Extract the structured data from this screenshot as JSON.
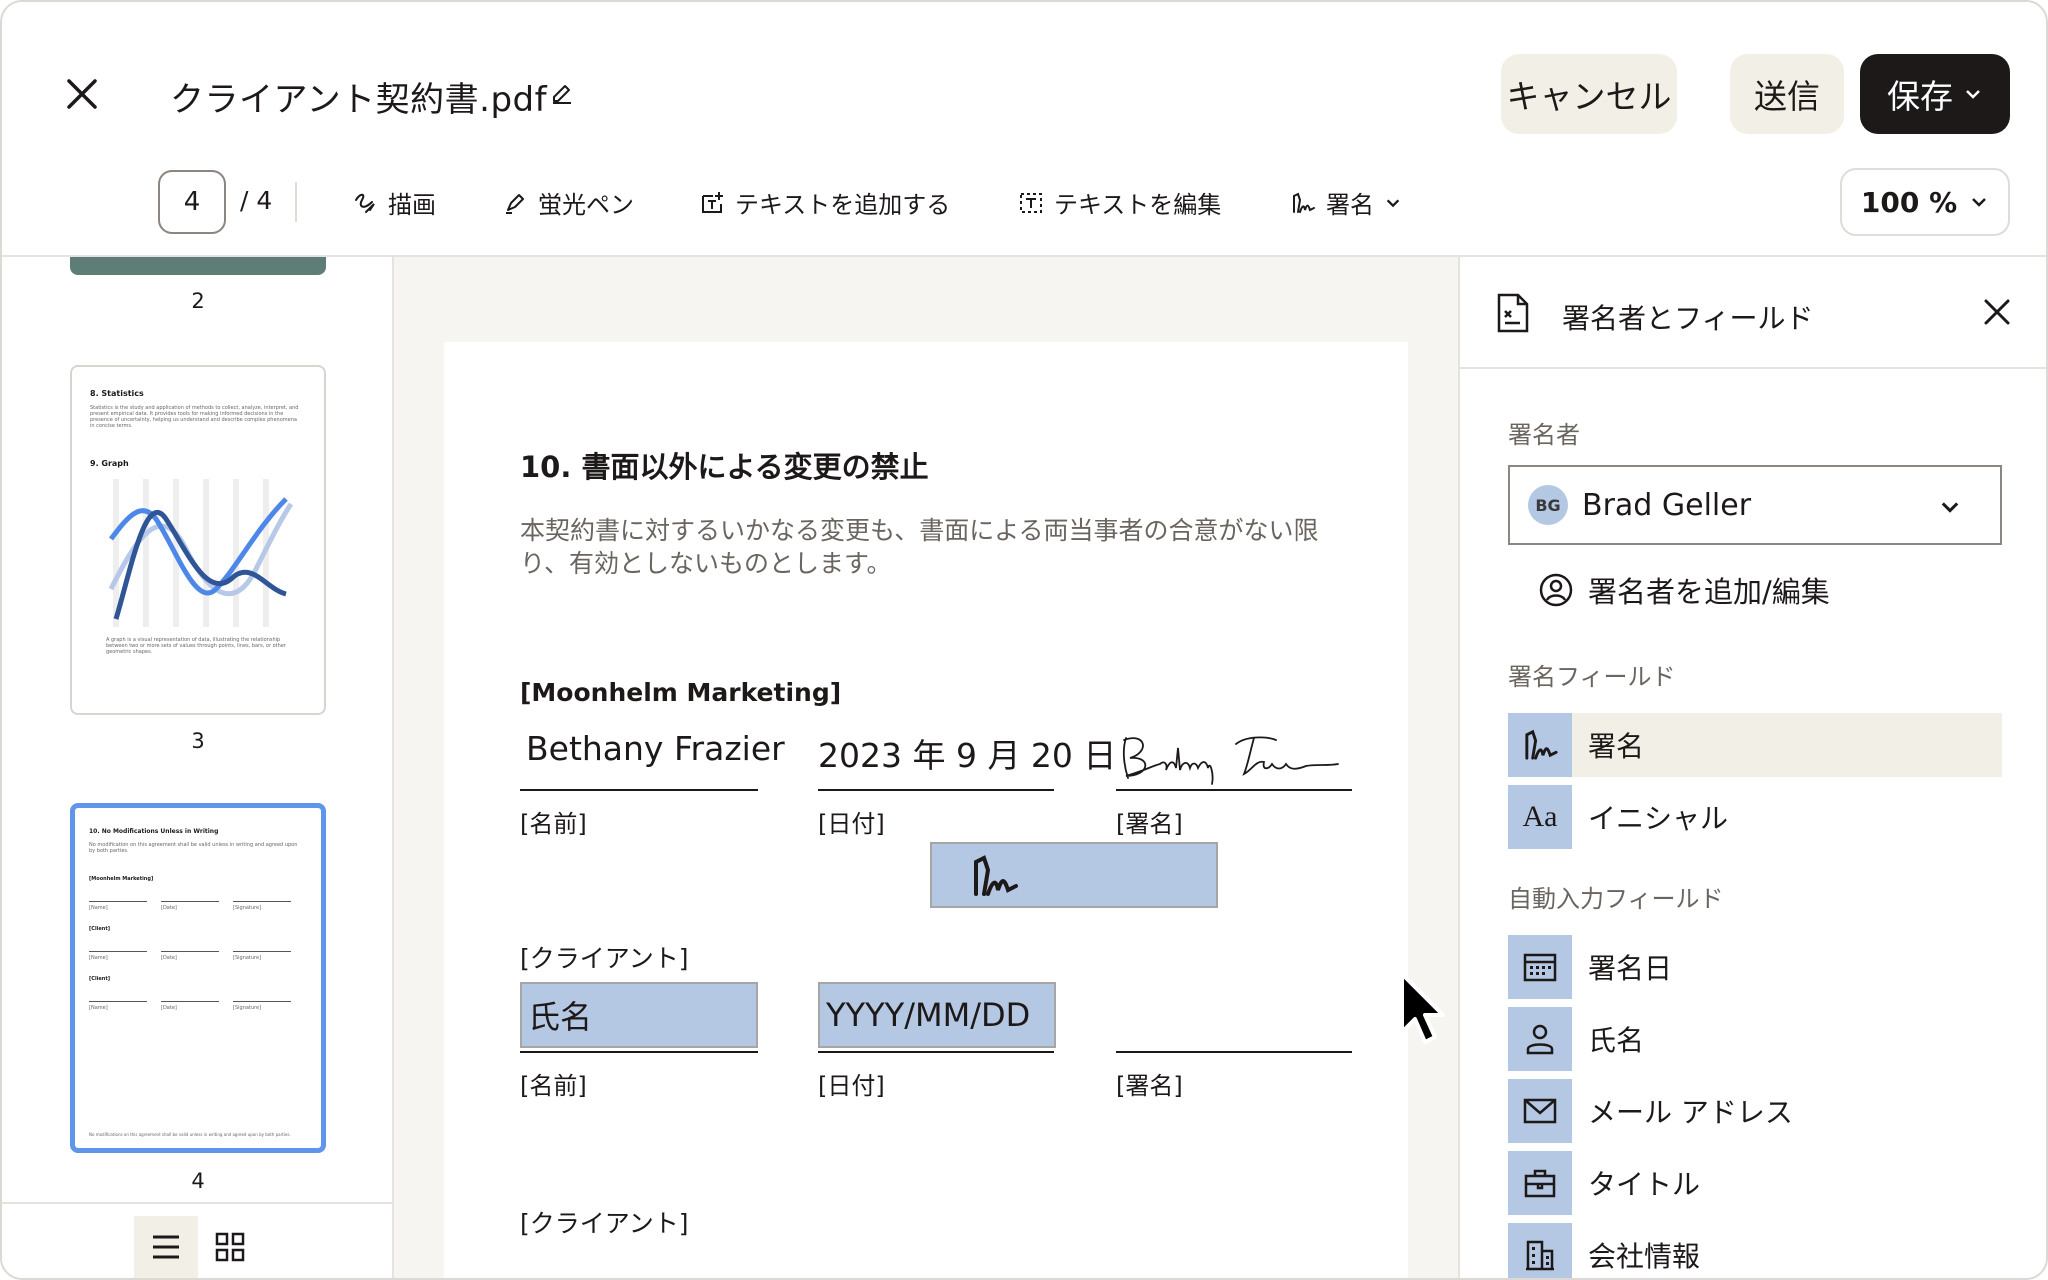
{
  "header": {
    "doc_title": "クライアント契約書.pdf",
    "cancel": "キャンセル",
    "send": "送信",
    "save": "保存"
  },
  "toolbar": {
    "current_page": "4",
    "total_pages": "/ 4",
    "draw": "描画",
    "highlighter": "蛍光ペン",
    "add_text": "テキストを追加する",
    "edit_text": "テキストを編集",
    "signature": "署名",
    "zoom": "100 %"
  },
  "thumbnails": {
    "labels": [
      "2",
      "3",
      "4"
    ],
    "page3": {
      "h1": "8. Statistics",
      "p1": "Statistics is the study and application of methods to collect, analyze, interpret, and present empirical data. It provides tools for making informed decisions in the presence of uncertainty, helping us understand and describe complex phenomena in concise terms.",
      "h2": "9. Graph",
      "p2": "A graph is a visual representation of data, illustrating the relationship between two or more sets of values through points, lines, bars, or other geometric shapes."
    },
    "page4": {
      "h1": "10. No Modifications Unless in Writing",
      "p1": "No modification on this agreement shall be valid unless in writing and agreed upon by both parties.",
      "party1": "[Moonhelm Marketing]",
      "party2": "[Client]",
      "party3": "[Client]",
      "name": "[Name]",
      "date": "[Date]",
      "sig": "[Signature]",
      "footer": "No modifications on this agreement shall be valid unless in writing and agreed upon by both parties."
    }
  },
  "document": {
    "section_title": "10. 書面以外による変更の禁止",
    "section_body": "本契約書に対するいかなる変更も、書面による両当事者の合意がない限り、有効としないものとします。",
    "party1": "[Moonhelm Marketing]",
    "party1_name": "Bethany Frazier",
    "party1_date": "2023 年 9 月 20 日",
    "party2": "[クライアント]",
    "party2_name_ph": "氏名",
    "party2_date_ph": "YYYY/MM/DD",
    "party3": "[クライアント]",
    "label_name": "[名前]",
    "label_date": "[日付]",
    "label_sig": "[署名]"
  },
  "panel": {
    "title": "署名者とフィールド",
    "signers_label": "署名者",
    "signer_initials": "BG",
    "signer_name": "Brad Geller",
    "add_signer": "署名者を追加/編集",
    "sig_fields_label": "署名フィールド",
    "sig_fields": [
      "署名",
      "イニシャル"
    ],
    "auto_fields_label": "自動入力フィールド",
    "auto_fields": [
      "署名日",
      "氏名",
      "メール アドレス",
      "タイトル",
      "会社情報"
    ]
  },
  "colors": {
    "accent_blue": "#b4c7e3",
    "selected_thumb": "#5f95ea",
    "dark": "#1e1919",
    "cream": "#f2efe6"
  }
}
